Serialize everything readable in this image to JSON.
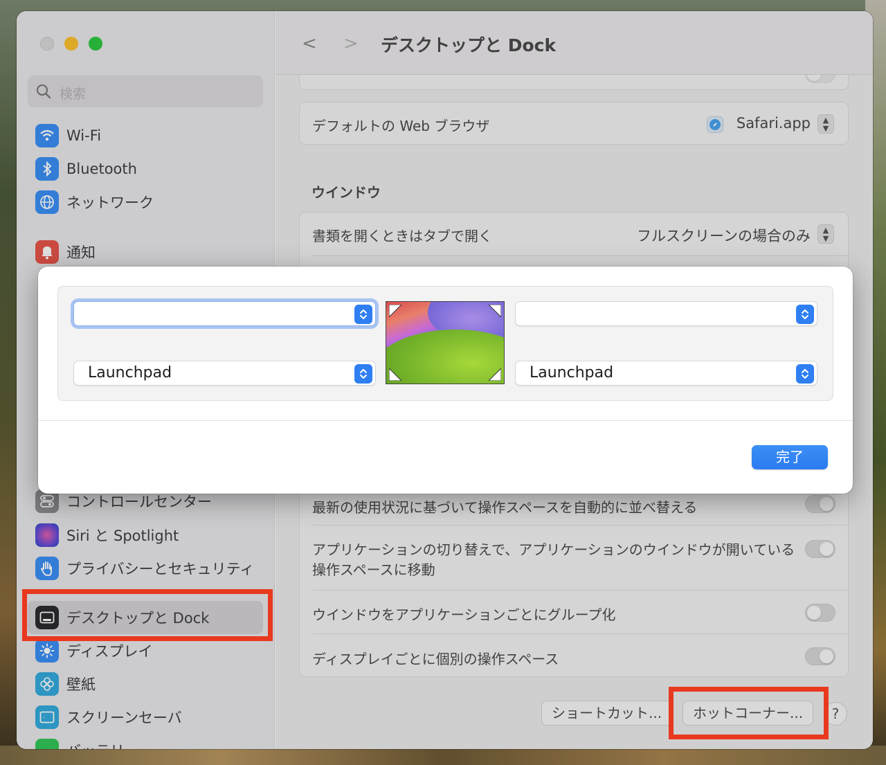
{
  "window": {
    "title": "デスクトップと Dock"
  },
  "sidebar": {
    "search_placeholder": "検索",
    "items": [
      {
        "label": "Wi-Fi",
        "icon": "wifi-icon",
        "color": "#3b8ff5"
      },
      {
        "label": "Bluetooth",
        "icon": "bluetooth-icon",
        "color": "#3b8ff5"
      },
      {
        "label": "ネットワーク",
        "icon": "globe-icon",
        "color": "#3b8ff5"
      },
      {
        "label": "通知",
        "icon": "bell-icon",
        "color": "#e8564a"
      },
      {
        "label": "コントロールセンター",
        "icon": "control-center-icon",
        "color": "#8e8e93"
      },
      {
        "label": "Siri と Spotlight",
        "icon": "siri-icon",
        "color": "#6a4dd8"
      },
      {
        "label": "プライバシーとセキュリティ",
        "icon": "hand-icon",
        "color": "#3b8ff5"
      },
      {
        "label": "デスクトップと Dock",
        "icon": "dock-icon",
        "color": "#1d1d1f"
      },
      {
        "label": "ディスプレイ",
        "icon": "sun-icon",
        "color": "#3b8ff5"
      },
      {
        "label": "壁紙",
        "icon": "flower-icon",
        "color": "#34aadc"
      },
      {
        "label": "スクリーンセーバ",
        "icon": "screensaver-icon",
        "color": "#34aadc"
      },
      {
        "label": "バッテリー",
        "icon": "battery-icon",
        "color": "#34c759"
      }
    ]
  },
  "main": {
    "default_browser_label": "デフォルトの Web ブラウザ",
    "default_browser_value": "Safari.app",
    "window_section": "ウインドウ",
    "tabs_label": "書類を開くときはタブで開く",
    "tabs_value": "フルスクリーンの場合のみ",
    "spaces_rows": [
      "最新の使用状況に基づいて操作スペースを自動的に並べ替える",
      "アプリケーションの切り替えで、アプリケーションのウインドウが開いている操作スペースに移動",
      "ウインドウをアプリケーションごとにグループ化",
      "ディスプレイごとに個別の操作スペース"
    ],
    "shortcuts_button": "ショートカット...",
    "hot_corners_button": "ホットコーナー...",
    "help_button": "?"
  },
  "dialog": {
    "top_left_value": "",
    "top_right_value": "",
    "bottom_left_value": "Launchpad",
    "bottom_right_value": "Launchpad",
    "done_button": "完了"
  },
  "colors": {
    "accent": "#2f7ff2",
    "callout": "#e8391f"
  }
}
